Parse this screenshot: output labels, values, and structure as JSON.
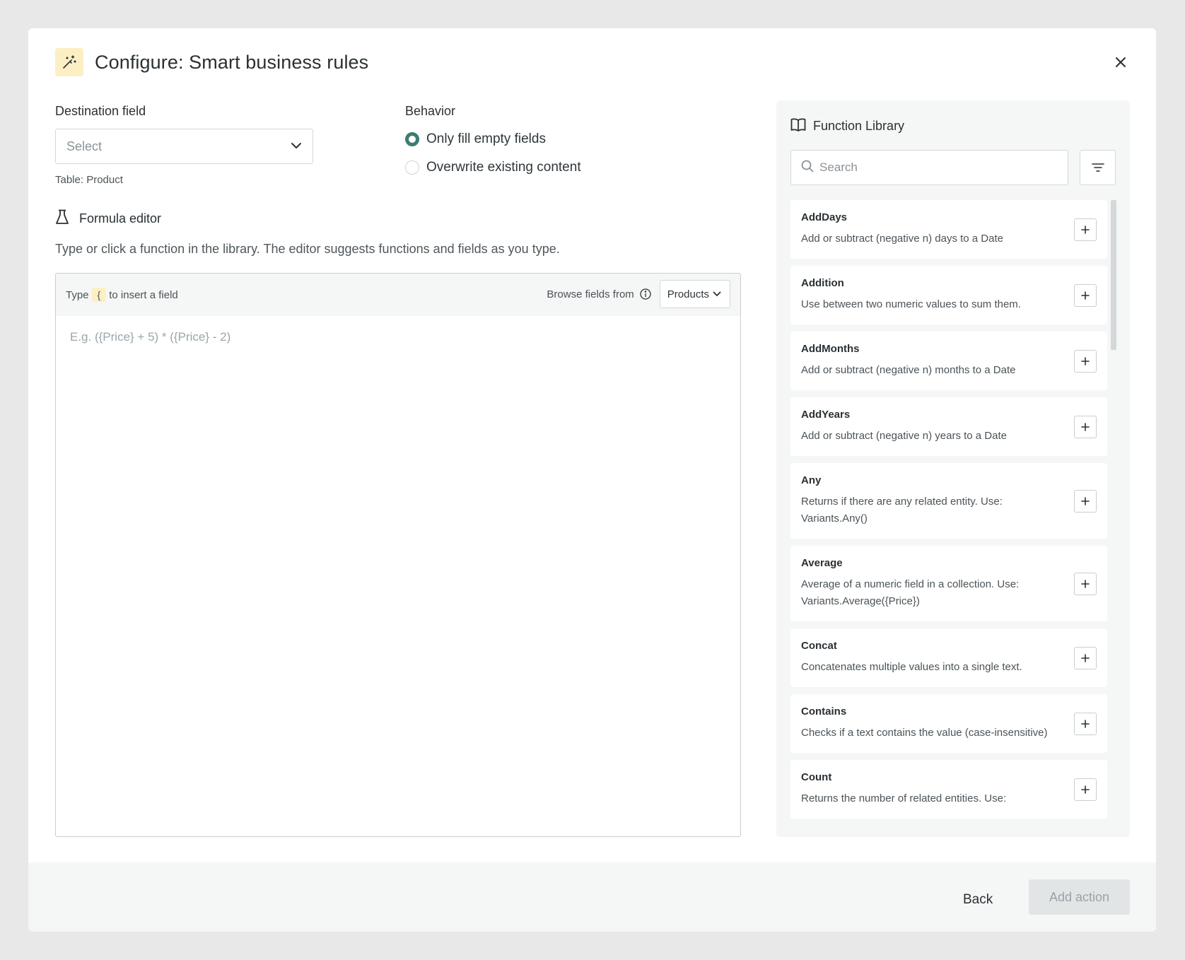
{
  "dialog": {
    "title": "Configure: Smart business rules",
    "icon": "magic-wand-icon",
    "close_icon": "close-icon"
  },
  "destination": {
    "label": "Destination field",
    "placeholder": "Select",
    "table_hint": "Table: Product"
  },
  "behavior": {
    "label": "Behavior",
    "options": [
      {
        "label": "Only fill empty fields",
        "selected": true
      },
      {
        "label": "Overwrite existing content",
        "selected": false
      }
    ]
  },
  "formula_editor": {
    "title": "Formula editor",
    "description": "Type or click a function in the library. The editor suggests functions and fields as you type.",
    "hint_prefix": "Type",
    "hint_key": "{",
    "hint_suffix": "to insert a field",
    "browse_label": "Browse fields from",
    "browse_value": "Products",
    "placeholder": "E.g. ({Price} + 5) * ({Price} - 2)"
  },
  "library": {
    "title": "Function Library",
    "search_placeholder": "Search",
    "functions": [
      {
        "name": "AddDays",
        "desc": "Add or subtract (negative n) days to a Date"
      },
      {
        "name": "Addition",
        "desc": "Use between two numeric values to sum them."
      },
      {
        "name": "AddMonths",
        "desc": "Add or subtract (negative n) months to a Date"
      },
      {
        "name": "AddYears",
        "desc": "Add or subtract (negative n) years to a Date"
      },
      {
        "name": "Any",
        "desc": "Returns if there are any related entity. Use: Variants.Any()"
      },
      {
        "name": "Average",
        "desc": "Average of a numeric field in a collection. Use: Variants.Average({Price})"
      },
      {
        "name": "Concat",
        "desc": "Concatenates multiple values into a single text."
      },
      {
        "name": "Contains",
        "desc": "Checks if a text contains the value (case-insensitive)"
      },
      {
        "name": "Count",
        "desc": "Returns the number of related entities. Use:"
      }
    ]
  },
  "footer": {
    "back_label": "Back",
    "add_label": "Add action"
  },
  "colors": {
    "accent": "#3e7c73",
    "highlight": "#fcefc4"
  }
}
